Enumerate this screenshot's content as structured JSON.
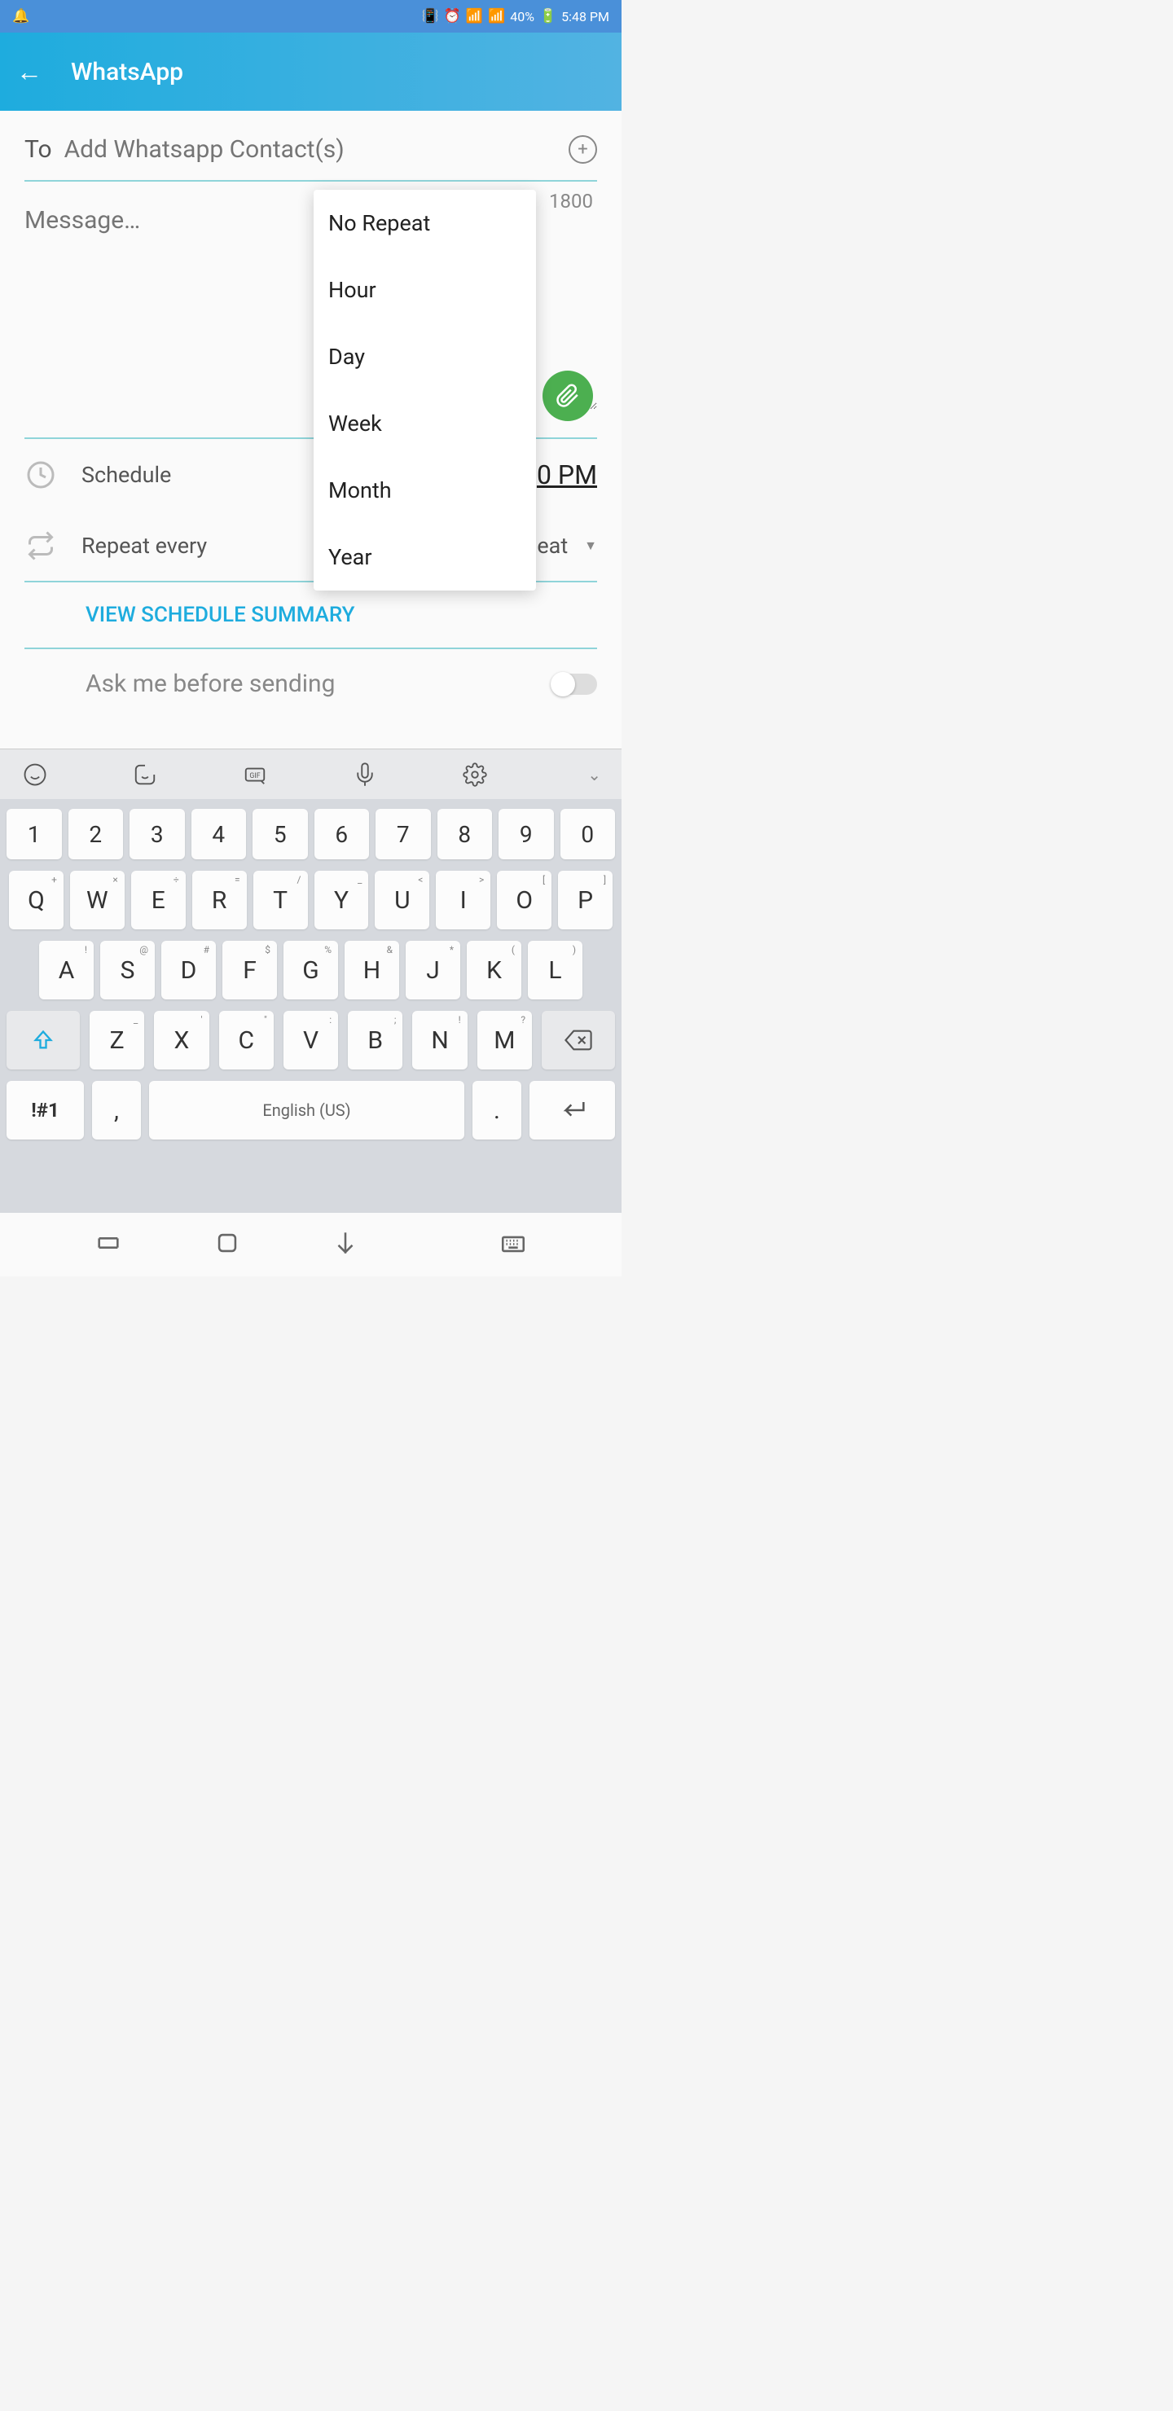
{
  "status": {
    "battery": "40%",
    "time": "5:48 PM"
  },
  "app_bar": {
    "title": "WhatsApp"
  },
  "to": {
    "label": "To",
    "placeholder": "Add Whatsapp Contact(s)"
  },
  "message": {
    "placeholder": "Message…",
    "char_count": "1800"
  },
  "schedule": {
    "label": "Schedule",
    "value": "0 PM"
  },
  "repeat": {
    "label": "Repeat every",
    "value": "No Repeat"
  },
  "view_summary": "VIEW SCHEDULE SUMMARY",
  "ask_before": "Ask me before sending",
  "dropdown": {
    "items": [
      "No Repeat",
      "Hour",
      "Day",
      "Week",
      "Month",
      "Year"
    ]
  },
  "keyboard": {
    "numbers": [
      "1",
      "2",
      "3",
      "4",
      "5",
      "6",
      "7",
      "8",
      "9",
      "0"
    ],
    "row1": [
      "Q",
      "W",
      "E",
      "R",
      "T",
      "Y",
      "U",
      "I",
      "O",
      "P"
    ],
    "row1_sub": [
      "+",
      "×",
      "÷",
      "=",
      "/",
      "_",
      "<",
      ">",
      "[",
      "]"
    ],
    "row2": [
      "A",
      "S",
      "D",
      "F",
      "G",
      "H",
      "J",
      "K",
      "L"
    ],
    "row2_sub": [
      "!",
      "@",
      "#",
      "$",
      "%",
      "&",
      "*",
      "(",
      ")"
    ],
    "row3": [
      "Z",
      "X",
      "C",
      "V",
      "B",
      "N",
      "M"
    ],
    "row3_sub": [
      "_",
      "'",
      "\"",
      ":",
      ";",
      "!",
      "?"
    ],
    "symbols": "!#1",
    "comma": ",",
    "space": "English (US)",
    "period": "."
  }
}
